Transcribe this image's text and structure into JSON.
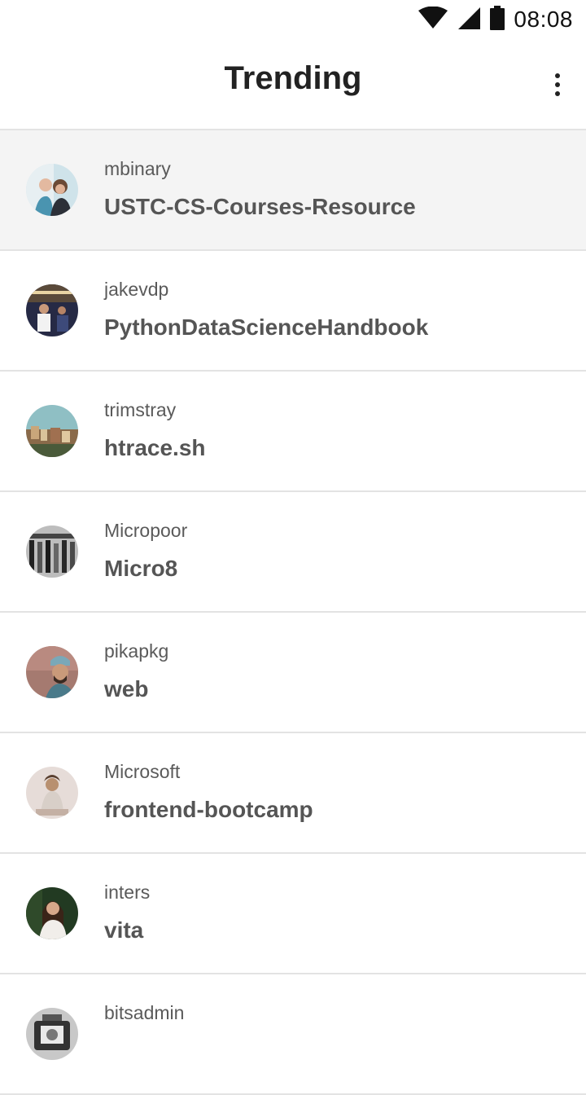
{
  "status_bar": {
    "time": "08:08",
    "icons": [
      "wifi-icon",
      "cell-signal-icon",
      "battery-icon"
    ]
  },
  "app_bar": {
    "title": "Trending",
    "menu_icon": "more-vert-icon"
  },
  "repos": [
    {
      "owner": "mbinary",
      "name": "USTC-CS-Courses-Resource",
      "selected": true
    },
    {
      "owner": "jakevdp",
      "name": "PythonDataScienceHandbook"
    },
    {
      "owner": "trimstray",
      "name": "htrace.sh"
    },
    {
      "owner": "Micropoor",
      "name": "Micro8"
    },
    {
      "owner": "pikapkg",
      "name": "web"
    },
    {
      "owner": "Microsoft",
      "name": "frontend-bootcamp"
    },
    {
      "owner": "inters",
      "name": "vita"
    },
    {
      "owner": "bitsadmin",
      "name": ""
    }
  ],
  "colors": {
    "selected_row_bg": "#f4f4f4",
    "divider": "#e3e3e3",
    "title_text": "#222222",
    "owner_text": "#5a5a5a",
    "repo_text": "#555555"
  }
}
